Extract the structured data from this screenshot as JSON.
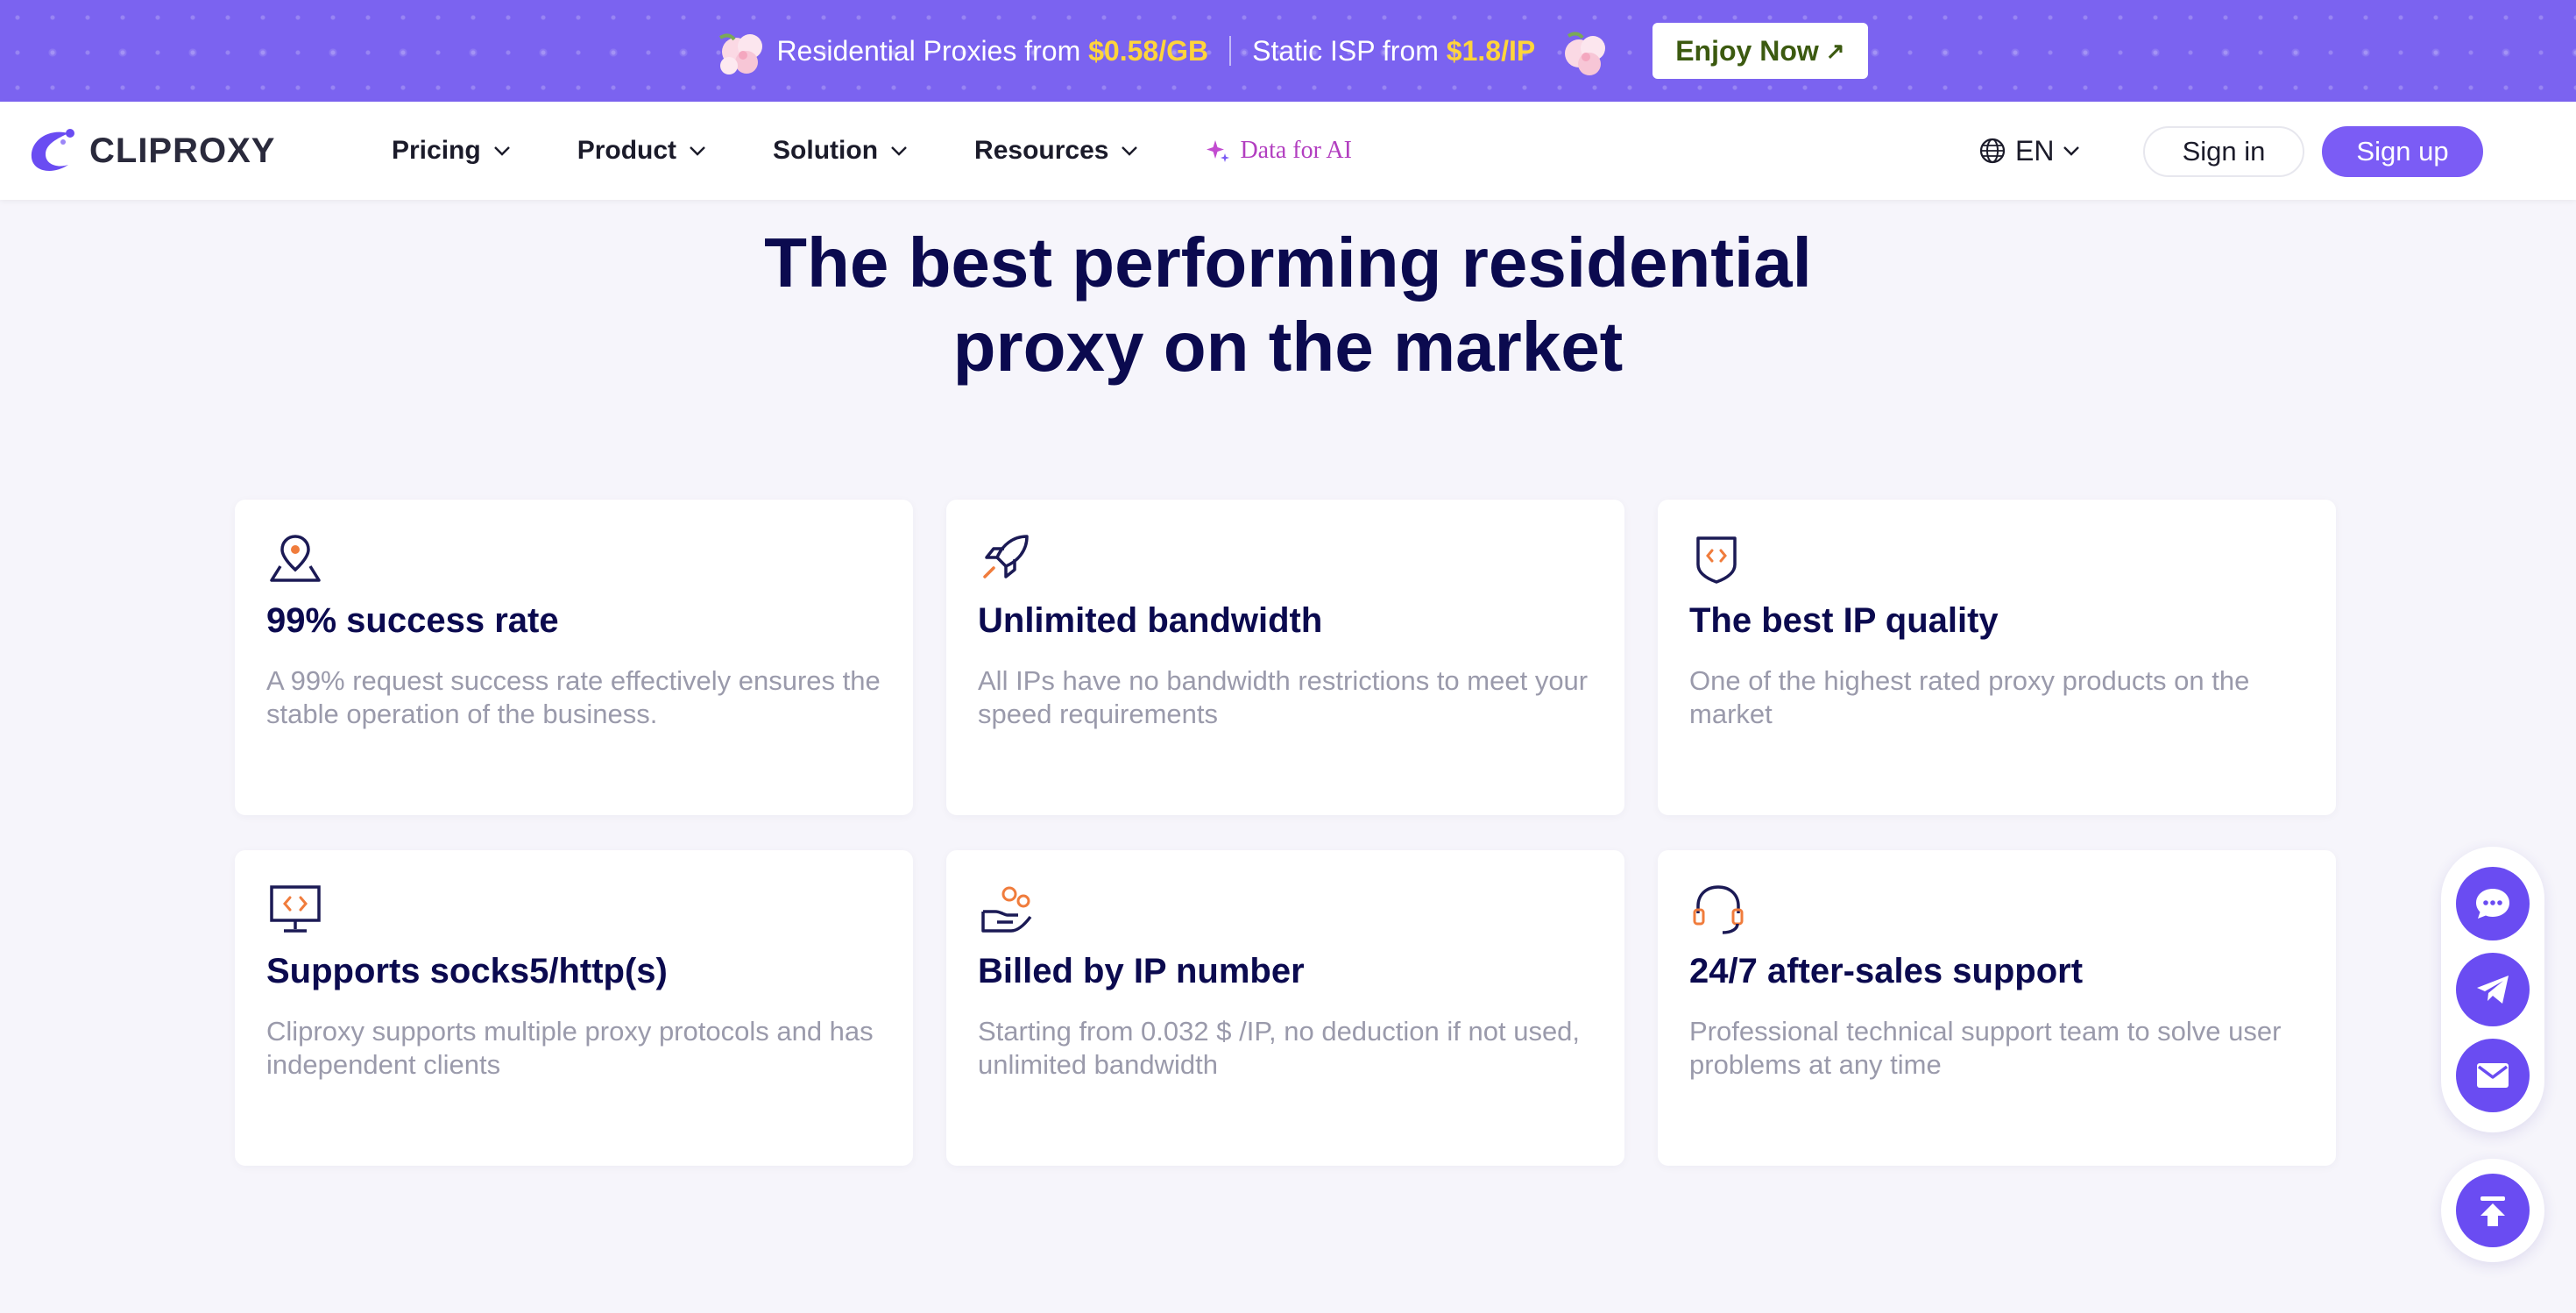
{
  "promo": {
    "text1": "Residential Proxies from ",
    "price1": "$0.58/GB",
    "text2": "Static ISP from ",
    "price2": "$1.8/IP",
    "cta": "Enjoy Now"
  },
  "brand": {
    "name": "CLIPROXY"
  },
  "nav": {
    "items": [
      {
        "label": "Pricing",
        "icon": "chevron-down-icon"
      },
      {
        "label": "Product",
        "icon": "chevron-down-icon"
      },
      {
        "label": "Solution",
        "icon": "chevron-down-icon"
      },
      {
        "label": "Resources",
        "icon": "chevron-down-icon"
      }
    ],
    "ai_label": "Data for AI",
    "language": "EN",
    "sign_in": "Sign in",
    "sign_up": "Sign up"
  },
  "hero": {
    "line1": "The best performing residential",
    "line2": "proxy on the market"
  },
  "features": [
    {
      "icon": "location-map-icon",
      "title": "99% success rate",
      "desc": "A 99% request success rate effectively ensures the stable operation of the business."
    },
    {
      "icon": "rocket-icon",
      "title": "Unlimited bandwidth",
      "desc": "All IPs have no bandwidth restrictions to meet your speed requirements"
    },
    {
      "icon": "shield-code-icon",
      "title": "The best IP quality",
      "desc": "One of the highest rated proxy products on the market"
    },
    {
      "icon": "monitor-code-icon",
      "title": "Supports socks5/http(s)",
      "desc": "Cliproxy supports multiple proxy protocols and has independent clients"
    },
    {
      "icon": "coins-hand-icon",
      "title": "Billed by IP number",
      "desc": "Starting from 0.032 $ /IP, no deduction if not used, unlimited bandwidth"
    },
    {
      "icon": "headset-icon",
      "title": "24/7 after-sales support",
      "desc": "Professional technical support team to solve user problems at any time"
    }
  ],
  "floating": [
    "chat-icon",
    "telegram-icon",
    "mail-icon",
    "back-to-top-icon"
  ],
  "colors": {
    "accent": "#7b5cf5",
    "banner": "#7b63f0",
    "price": "#ffd43b",
    "heading": "#0b0a4f",
    "icon_orange": "#f07c3c"
  }
}
